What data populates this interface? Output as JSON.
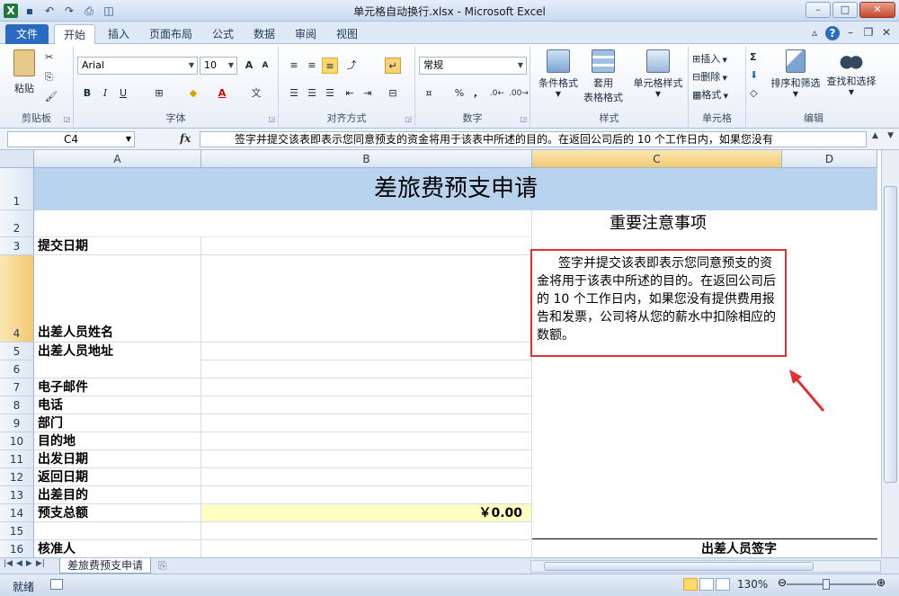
{
  "window": {
    "title": "单元格自动换行.xlsx - Microsoft Excel"
  },
  "tabs": [
    "文件",
    "开始",
    "插入",
    "页面布局",
    "公式",
    "数据",
    "审阅",
    "视图"
  ],
  "ribbon": {
    "clipboard": {
      "paste": "粘贴",
      "label": "剪贴板"
    },
    "font": {
      "name": "Arial",
      "size": "10",
      "bold": "B",
      "italic": "I",
      "underline": "U",
      "label": "字体"
    },
    "alignment": {
      "label": "对齐方式"
    },
    "number": {
      "format": "常规",
      "percent": "%",
      "comma": ",",
      "label": "数字"
    },
    "styles": {
      "conditional": "条件格式",
      "table_format_1": "套用",
      "table_format_2": "表格格式",
      "cell_styles": "单元格样式",
      "label": "样式"
    },
    "cells": {
      "insert": "插入",
      "delete": "删除",
      "format": "格式",
      "label": "单元格"
    },
    "editing": {
      "sum": "Σ",
      "sort_filter": "排序和筛选",
      "find_select": "查找和选择",
      "label": "编辑"
    }
  },
  "formula_bar": {
    "name_box": "C4",
    "fx": "fx",
    "content": "签字并提交该表即表示您同意预支的资金将用于该表中所述的目的。在返回公司后的 10 个工作日内，如果您没有"
  },
  "columns": [
    "A",
    "B",
    "C",
    "D"
  ],
  "rows": [
    "1",
    "2",
    "3",
    "4",
    "5",
    "6",
    "7",
    "8",
    "9",
    "10",
    "11",
    "12",
    "13",
    "14",
    "15",
    "16"
  ],
  "sheet": {
    "banner": "差旅费预支申请",
    "labels": {
      "r3": "提交日期",
      "r4": "出差人员姓名",
      "r5": "出差人员地址",
      "r7": "电子邮件",
      "r8": "电话",
      "r9": "部门",
      "r10": "目的地",
      "r11": "出发日期",
      "r12": "返回日期",
      "r13": "出差目的",
      "r14": "预支总额",
      "r16": "核准人"
    },
    "amount": "￥0.00",
    "notice_title": "重要注意事项",
    "notice_text": "签字并提交该表即表示您同意预支的资金将用于该表中所述的目的。在返回公司后的 10 个工作日内，如果您没有提供费用报告和发票，公司将从您的薪水中扣除相应的数额。",
    "signature_label": "出差人员签字"
  },
  "sheet_tabs": [
    "差旅费预支申请"
  ],
  "status": {
    "ready": "就绪",
    "zoom": "130%"
  },
  "colors": {
    "banner": "#b9d3ef",
    "highlight_border": "#e03030",
    "amount_fill": "#ffffc2"
  }
}
